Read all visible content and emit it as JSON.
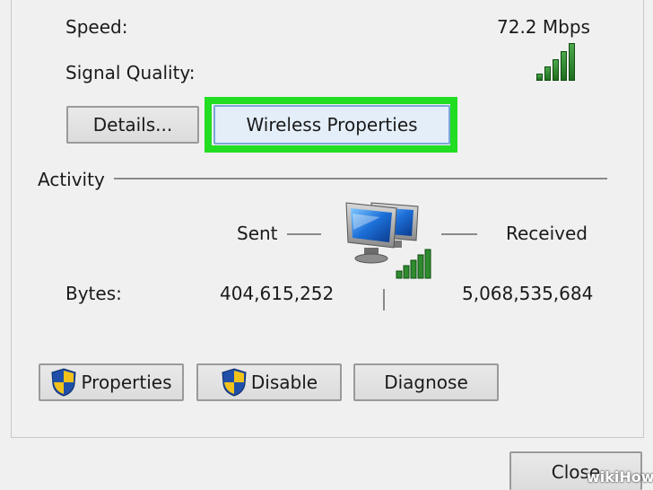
{
  "connection": {
    "speed_label": "Speed:",
    "speed_value": "72.2 Mbps",
    "signal_label": "Signal Quality:"
  },
  "buttons": {
    "details": "Details...",
    "wireless_properties": "Wireless Properties",
    "properties": "Properties",
    "disable": "Disable",
    "diagnose": "Diagnose",
    "close": "Close"
  },
  "activity": {
    "title": "Activity",
    "sent_label": "Sent",
    "received_label": "Received",
    "bytes_label": "Bytes:",
    "bytes_sent": "404,615,252",
    "bytes_received": "5,068,535,684"
  },
  "watermark": "wikiHow",
  "colors": {
    "highlight": "#22dd22",
    "signal_green": "#2e8b2e",
    "shield_blue": "#1f4fa8",
    "shield_yellow": "#f2c21a"
  },
  "icons": [
    "signal-bars-icon",
    "network-computers-icon",
    "uac-shield-icon"
  ]
}
